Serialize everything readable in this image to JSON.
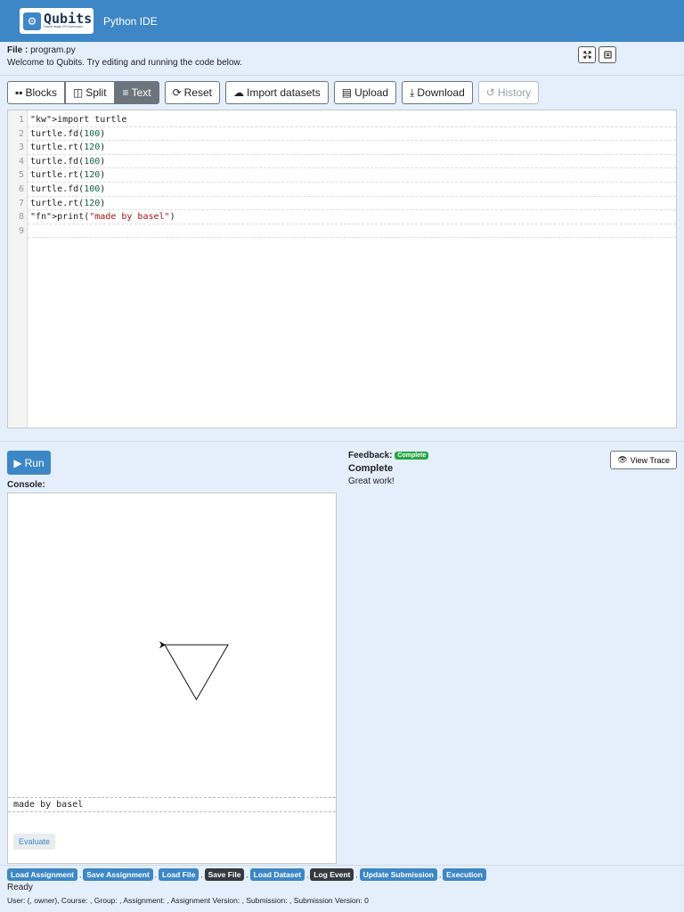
{
  "header": {
    "logo_name": "Qubits",
    "logo_tag": "Future ready CS Curriculum",
    "app_title": "Python IDE"
  },
  "file": {
    "label": "File :",
    "name": "program.py",
    "welcome": "Welcome to Qubits. Try editing and running the code below."
  },
  "toolbar": {
    "blocks": "Blocks",
    "split": "Split",
    "text": "Text",
    "reset": "Reset",
    "import_datasets": "Import datasets",
    "upload": "Upload",
    "download": "Download",
    "history": "History"
  },
  "editor": {
    "line_numbers": [
      "1",
      "2",
      "3",
      "4",
      "5",
      "6",
      "7",
      "8",
      "9"
    ],
    "lines": [
      "import turtle",
      "turtle.fd(100)",
      "turtle.rt(120)",
      "turtle.fd(100)",
      "turtle.rt(120)",
      "turtle.fd(100)",
      "turtle.rt(120)",
      "print(\"made by basel\")",
      ""
    ]
  },
  "run": {
    "label": "Run",
    "console_label": "Console:",
    "output": "made by basel",
    "evaluate": "Evaluate"
  },
  "feedback": {
    "label": "Feedback:",
    "badge": "Complete",
    "status": "Complete",
    "message": "Great work!",
    "view_trace": "View Trace"
  },
  "footer": {
    "events": [
      {
        "label": "Load Assignment",
        "style": "blue"
      },
      {
        "label": "Save Assignment",
        "style": "blue"
      },
      {
        "label": "Load File",
        "style": "blue"
      },
      {
        "label": "Save File",
        "style": "dark"
      },
      {
        "label": "Load Dataset",
        "style": "blue"
      },
      {
        "label": "Log Event",
        "style": "dark"
      },
      {
        "label": "Update Submission",
        "style": "blue"
      },
      {
        "label": "Execution",
        "style": "blue"
      }
    ],
    "status": "Ready",
    "user_info": "User: (, owner), Course: , Group: , Assignment: , Assignment Version: , Submission: , Submission Version: 0"
  },
  "colors": {
    "primary": "#3d87c6",
    "background": "#e4effb",
    "success": "#28a745",
    "dark": "#343a40"
  }
}
